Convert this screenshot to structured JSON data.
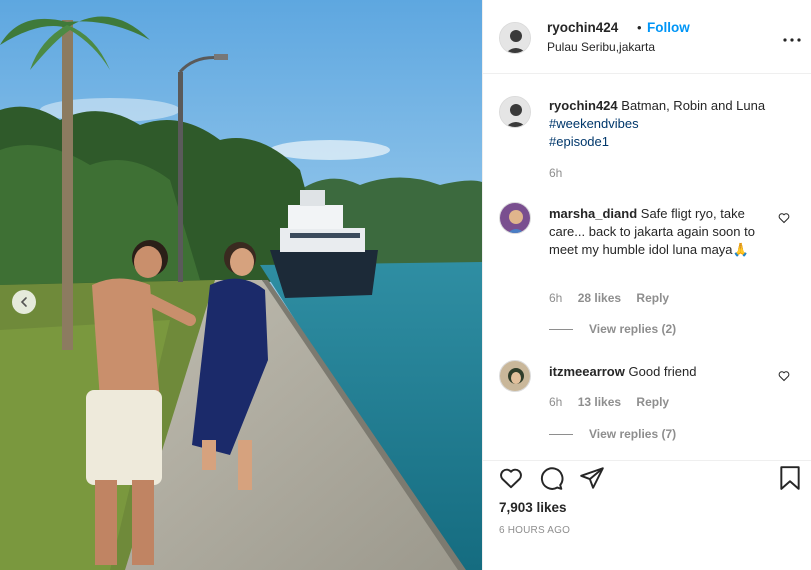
{
  "post": {
    "username": "ryochin424",
    "separator": "•",
    "follow_label": "Follow",
    "location": "Pulau Seribu,jakarta"
  },
  "caption": {
    "username": "ryochin424",
    "text": "Batman, Robin and Luna",
    "hashtags": [
      "#weekendvibes",
      "#episode1"
    ],
    "time": "6h"
  },
  "comments": [
    {
      "username": "marsha_diand",
      "text": "Safe fligt ryo, take care... back to jakarta again soon to meet my humble idol luna maya🙏",
      "time": "6h",
      "likes": "28 likes",
      "reply_label": "Reply",
      "view_replies": "View replies (2)"
    },
    {
      "username": "itzmeearrow",
      "text": "Good friend",
      "time": "6h",
      "likes": "13 likes",
      "reply_label": "Reply",
      "view_replies": "View replies (7)"
    }
  ],
  "stats": {
    "likes": "7,903 likes",
    "time_ago": "6 HOURS AGO"
  },
  "icons": {
    "more": "more-options-icon",
    "like": "heart-icon",
    "comment": "comment-icon",
    "share": "share-icon",
    "save": "bookmark-icon",
    "prev": "chevron-left-icon"
  },
  "colors": {
    "link": "#0095f6",
    "hashtag": "#00376b",
    "muted": "#8e8e8e",
    "text": "#262626"
  }
}
